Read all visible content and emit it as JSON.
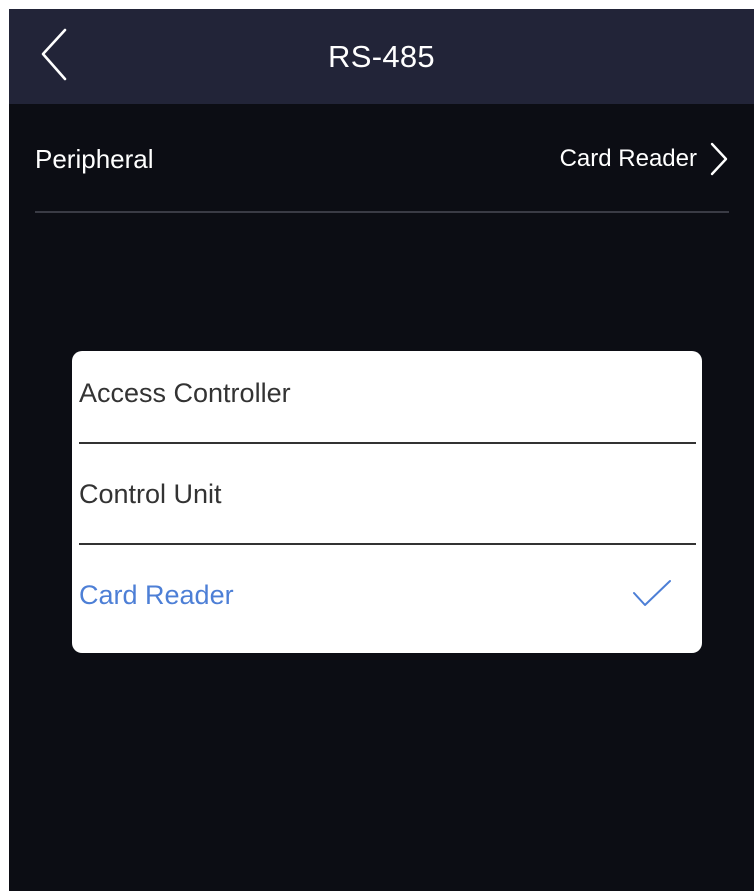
{
  "header": {
    "title": "RS-485"
  },
  "peripheral_row": {
    "label": "Peripheral",
    "value": "Card Reader"
  },
  "popup": {
    "options": [
      {
        "label": "Access Controller",
        "selected": false
      },
      {
        "label": "Control Unit",
        "selected": false
      },
      {
        "label": "Card Reader",
        "selected": true
      }
    ]
  },
  "colors": {
    "background": "#0c0d14",
    "header": "#222438",
    "accent": "#4d7fd6",
    "popup_bg": "#ffffff",
    "option_text": "#333333"
  },
  "icons": {
    "back": "chevron-left-icon",
    "row_arrow": "chevron-right-icon",
    "selected_mark": "checkmark-icon"
  }
}
